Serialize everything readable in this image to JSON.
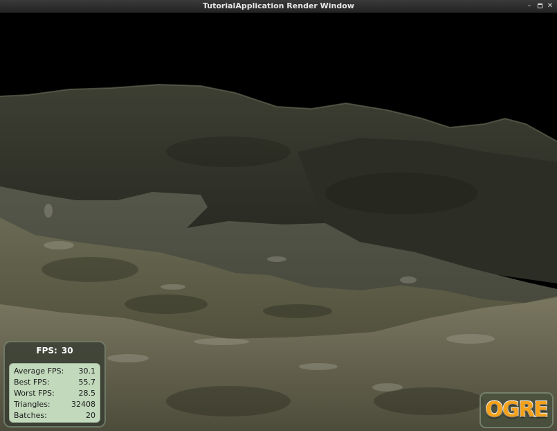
{
  "window": {
    "title": "TutorialApplication Render Window",
    "controls": {
      "minimize": "minimize-icon",
      "maximize": "maximize-icon",
      "close": "close-icon"
    }
  },
  "scene": {
    "sky_color": "#000000",
    "terrain_colors": [
      "#3c3e32",
      "#4a4c3c",
      "#5c5d48",
      "#6e6c55",
      "#2a2b22"
    ]
  },
  "stats": {
    "fps_label": "FPS:",
    "fps_value": "30",
    "rows": [
      {
        "label": "Average FPS:",
        "value": "30.1"
      },
      {
        "label": "Best FPS:",
        "value": "55.7"
      },
      {
        "label": "Worst FPS:",
        "value": "28.5"
      },
      {
        "label": "Triangles:",
        "value": "32408"
      },
      {
        "label": "Batches:",
        "value": "20"
      }
    ]
  },
  "logo": {
    "text": "OGRE",
    "color": "#f5a21b"
  }
}
